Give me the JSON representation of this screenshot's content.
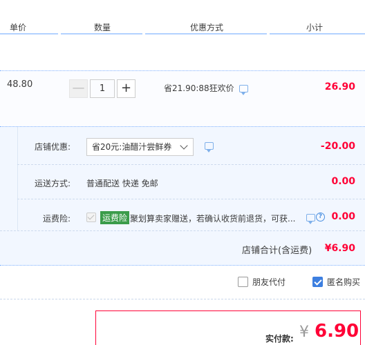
{
  "columns": {
    "unit_price": "单价",
    "quantity": "数量",
    "discount_method": "优惠方式",
    "subtotal": "小计"
  },
  "item": {
    "unit_price": "48.80",
    "quantity": "1",
    "minus": "—",
    "plus": "+",
    "promo": "省21.90:88狂欢价",
    "subtotal": "26.90"
  },
  "shop": {
    "coupon_label": "店铺优惠:",
    "coupon_value": "省20元:油醋汁尝鲜券",
    "coupon_amount": "-20.00",
    "shipping_label": "运送方式:",
    "shipping_value": "普通配送 快递 免邮",
    "shipping_amount": "0.00",
    "insurance_label": "运费险:",
    "insurance_tag": "运费险",
    "insurance_text": "聚划算卖家赠送，若确认收货前退货，可获...",
    "insurance_amount": "0.00",
    "total_label": "店铺合计(含运费)",
    "total_amount": "¥6.90"
  },
  "options": {
    "friend_pay": "朋友代付",
    "anonymous": "匿名购买"
  },
  "payment": {
    "label": "实付款:",
    "currency": "¥",
    "amount": "6.90"
  },
  "colors": {
    "price_red": "#ff0036",
    "accent_blue": "#3d7fe0",
    "shop_bg": "#f2f7ff",
    "tag_green": "#3b9c4a"
  }
}
